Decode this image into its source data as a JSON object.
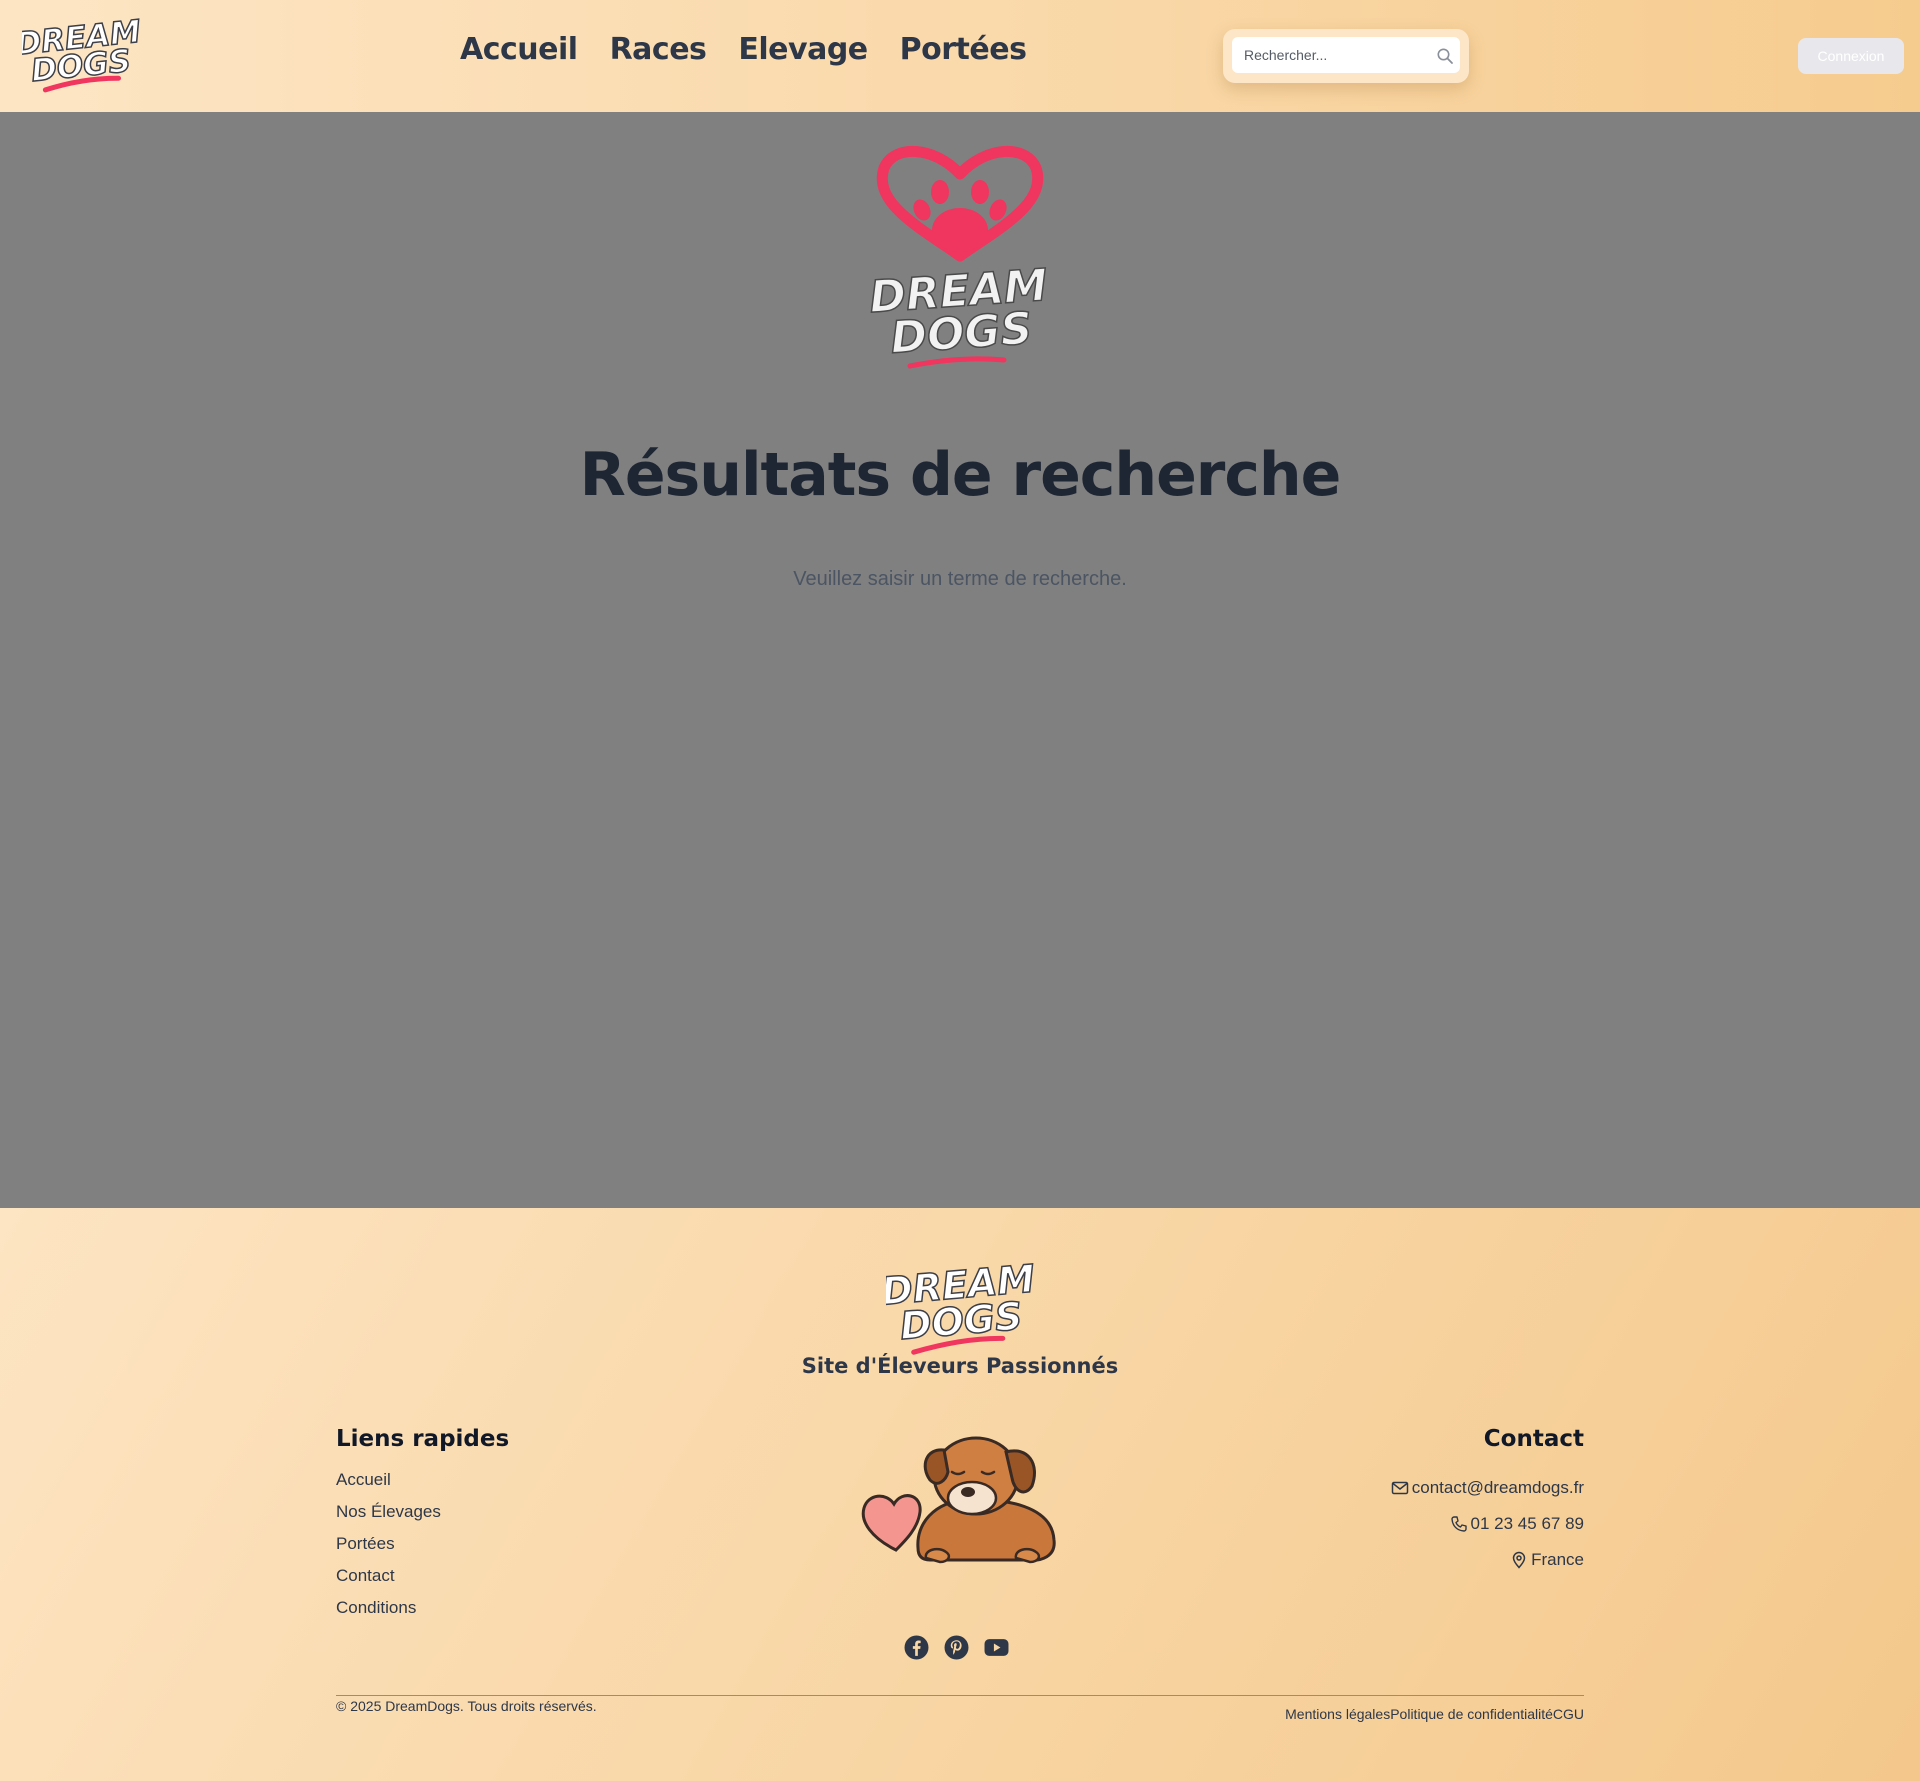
{
  "brand": {
    "name_line1": "DREAM",
    "name_line2": "DOGS",
    "accent_color": "#f0355f"
  },
  "header": {
    "nav": [
      "Accueil",
      "Races",
      "Elevage",
      "Portées"
    ],
    "search": {
      "placeholder": "Rechercher...",
      "value": ""
    },
    "login_label": "Connexion"
  },
  "main": {
    "title": "Résultats de recherche",
    "empty_message": "Veuillez saisir un terme de recherche."
  },
  "footer": {
    "tagline": "Site d'Éleveurs Passionnés",
    "quick_links": {
      "title": "Liens rapides",
      "items": [
        "Accueil",
        "Nos Élevages",
        "Portées",
        "Contact",
        "Conditions"
      ]
    },
    "contact": {
      "title": "Contact",
      "email": "contact@dreamdogs.fr",
      "phone": "01 23 45 67 89",
      "location": "France"
    },
    "social": [
      "facebook-icon",
      "pinterest-icon",
      "youtube-icon"
    ],
    "copyright": "© 2025 DreamDogs. Tous droits réservés.",
    "legal": [
      "Mentions légales",
      "Politique de confidentialité",
      "CGU"
    ]
  }
}
